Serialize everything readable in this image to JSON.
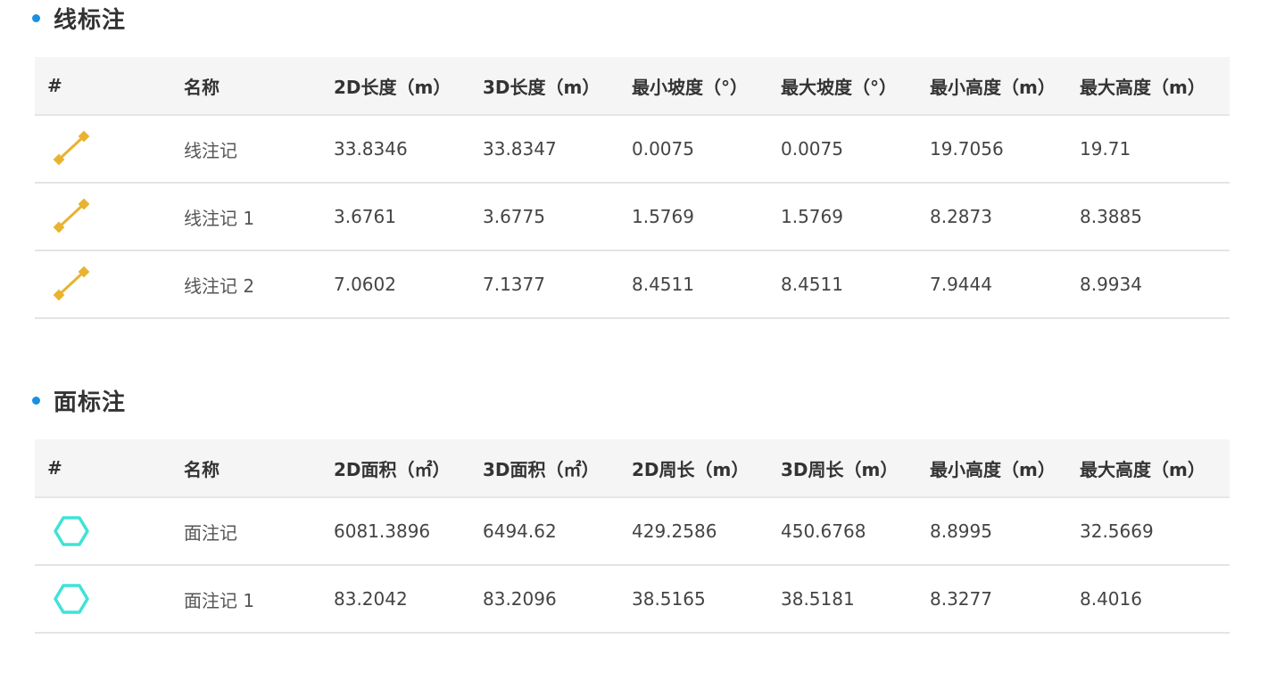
{
  "colors": {
    "accent_dot": "#1a8fe3",
    "line_icon": "#e8b330",
    "polygon_icon": "#3fe3d6",
    "header_bg": "#f5f5f5"
  },
  "line_section": {
    "title": "线标注",
    "headers": [
      "#",
      "名称",
      "2D长度（m）",
      "3D长度（m）",
      "最小坡度（°）",
      "最大坡度（°）",
      "最小高度（m）",
      "最大高度（m）"
    ],
    "rows": [
      {
        "icon": "line-annotation-icon",
        "name": "线注记",
        "len2d": "33.8346",
        "len3d": "33.8347",
        "min_slope": "0.0075",
        "max_slope": "0.0075",
        "min_height": "19.7056",
        "max_height": "19.71"
      },
      {
        "icon": "line-annotation-icon",
        "name": "线注记 1",
        "len2d": "3.6761",
        "len3d": "3.6775",
        "min_slope": "1.5769",
        "max_slope": "1.5769",
        "min_height": "8.2873",
        "max_height": "8.3885"
      },
      {
        "icon": "line-annotation-icon",
        "name": "线注记 2",
        "len2d": "7.0602",
        "len3d": "7.1377",
        "min_slope": "8.4511",
        "max_slope": "8.4511",
        "min_height": "7.9444",
        "max_height": "8.9934"
      }
    ]
  },
  "area_section": {
    "title": "面标注",
    "headers": [
      "#",
      "名称",
      "2D面积（㎡）",
      "3D面积（㎡）",
      "2D周长（m）",
      "3D周长（m）",
      "最小高度（m）",
      "最大高度（m）"
    ],
    "rows": [
      {
        "icon": "polygon-annotation-icon",
        "name": "面注记",
        "area2d": "6081.3896",
        "area3d": "6494.62",
        "perim2d": "429.2586",
        "perim3d": "450.6768",
        "min_height": "8.8995",
        "max_height": "32.5669"
      },
      {
        "icon": "polygon-annotation-icon",
        "name": "面注记 1",
        "area2d": "83.2042",
        "area3d": "83.2096",
        "perim2d": "38.5165",
        "perim3d": "38.5181",
        "min_height": "8.3277",
        "max_height": "8.4016"
      }
    ]
  }
}
